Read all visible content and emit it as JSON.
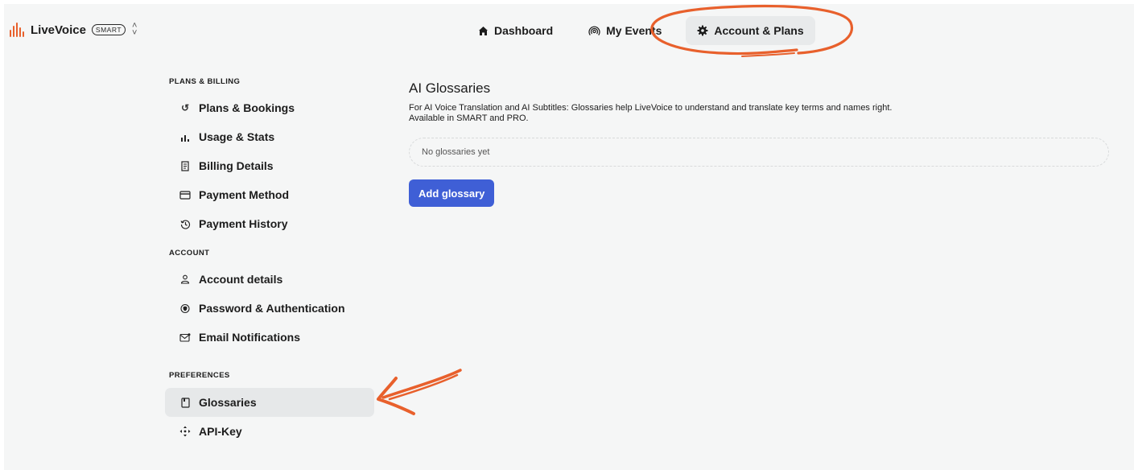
{
  "brand": {
    "name": "LiveVoice",
    "badge": "SMART",
    "switch_icon": "chevron-up-down-icon"
  },
  "topnav": {
    "items": [
      {
        "label": "Dashboard",
        "icon": "home-icon"
      },
      {
        "label": "My Events",
        "icon": "broadcast-icon"
      },
      {
        "label": "Account & Plans",
        "icon": "gear-icon",
        "active": true
      }
    ]
  },
  "sidebar": {
    "sections": [
      {
        "title": "PLANS & BILLING",
        "items": [
          {
            "label": "Plans & Bookings",
            "icon": "plans-icon"
          },
          {
            "label": "Usage & Stats",
            "icon": "bar-chart-icon"
          },
          {
            "label": "Billing Details",
            "icon": "receipt-icon"
          },
          {
            "label": "Payment Method",
            "icon": "credit-card-icon"
          },
          {
            "label": "Payment History",
            "icon": "history-icon"
          }
        ]
      },
      {
        "title": "ACCOUNT",
        "items": [
          {
            "label": "Account details",
            "icon": "user-icon"
          },
          {
            "label": "Password & Authentication",
            "icon": "shield-icon"
          },
          {
            "label": "Email Notifications",
            "icon": "mail-icon"
          }
        ]
      },
      {
        "title": "PREFERENCES",
        "items": [
          {
            "label": "Glossaries",
            "icon": "book-icon",
            "active": true
          },
          {
            "label": "API-Key",
            "icon": "move-arrows-icon"
          }
        ]
      }
    ]
  },
  "main": {
    "title": "AI Glossaries",
    "description_line1": "For AI Voice Translation and AI Subtitles: Glossaries help LiveVoice to understand and translate key terms and names right.",
    "description_line2": "Available in SMART and PRO.",
    "empty_text": "No glossaries yet",
    "add_button": "Add glossary"
  },
  "colors": {
    "accent": "#3f5fd6",
    "annotation": "#e8602c",
    "background": "#f5f6f6"
  }
}
